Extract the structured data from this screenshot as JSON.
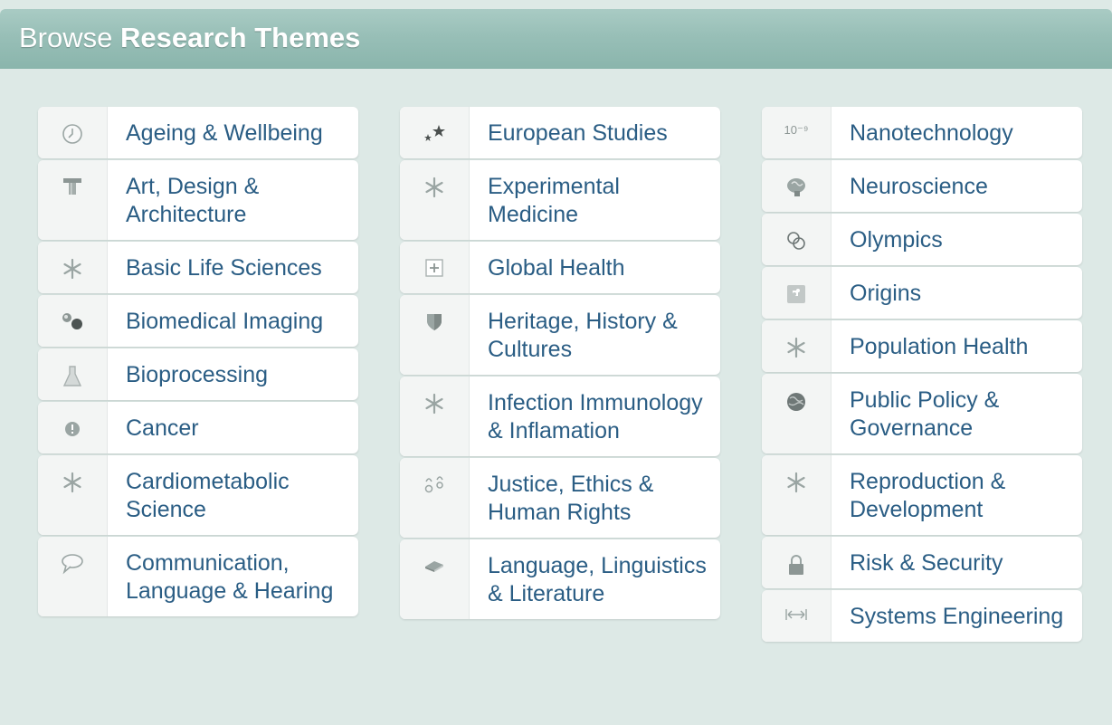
{
  "header": {
    "title_light": "Browse",
    "title_bold": "Research Themes"
  },
  "columns": [
    {
      "items": [
        {
          "label": "Ageing & Wellbeing",
          "icon": "clock-icon"
        },
        {
          "label": "Art, Design & Architecture",
          "icon": "column-icon"
        },
        {
          "label": "Basic Life Sciences",
          "icon": "asterisk-icon"
        },
        {
          "label": "Biomedical Imaging",
          "icon": "capsule-icon"
        },
        {
          "label": "Bioprocessing",
          "icon": "flask-icon"
        },
        {
          "label": "Cancer",
          "icon": "alert-icon"
        },
        {
          "label": "Cardiometabolic Science",
          "icon": "asterisk-icon"
        },
        {
          "label": "Communication, Language & Hearing",
          "icon": "speech-bubble-icon"
        }
      ]
    },
    {
      "items": [
        {
          "label": "European Studies",
          "icon": "stars-icon"
        },
        {
          "label": "Experimental Medicine",
          "icon": "asterisk-icon"
        },
        {
          "label": "Global Health",
          "icon": "plus-box-icon"
        },
        {
          "label": "Heritage, History & Cultures",
          "icon": "shield-icon"
        },
        {
          "label": "Infection Immunology & Inflamation",
          "icon": "asterisk-icon"
        },
        {
          "label": "Justice, Ethics & Human Rights",
          "icon": "scales-icon"
        },
        {
          "label": "Language, Linguistics & Literature",
          "icon": "book-icon"
        }
      ]
    },
    {
      "items": [
        {
          "label": "Nanotechnology",
          "icon": "ten-power-icon",
          "icon_text": "10⁻⁹"
        },
        {
          "label": "Neuroscience",
          "icon": "brain-icon"
        },
        {
          "label": "Olympics",
          "icon": "rings-icon"
        },
        {
          "label": "Origins",
          "icon": "puzzle-icon"
        },
        {
          "label": "Population Health",
          "icon": "asterisk-icon"
        },
        {
          "label": "Public Policy & Governance",
          "icon": "globe-icon"
        },
        {
          "label": "Reproduction & Development",
          "icon": "asterisk-icon"
        },
        {
          "label": "Risk & Security",
          "icon": "lock-icon"
        },
        {
          "label": "Systems Engineering",
          "icon": "width-arrows-icon"
        }
      ]
    }
  ],
  "colors": {
    "background": "#dde9e6",
    "header": "#98bfb7",
    "link": "#2a5d84",
    "icon": "#9aa5a3"
  }
}
